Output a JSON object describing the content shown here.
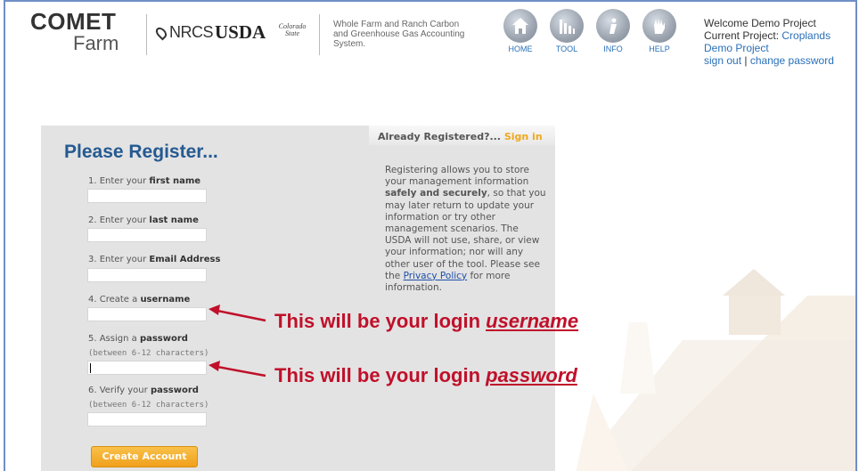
{
  "header": {
    "logo_comet": "COMET",
    "logo_farm": "Farm",
    "logo_nrcs": "NRCS",
    "logo_usda": "USDA",
    "logo_csu": "Colorado State",
    "tagline": "Whole Farm and Ranch Carbon and Greenhouse Gas Accounting System.",
    "nav": [
      {
        "label": "HOME",
        "icon": "home-icon"
      },
      {
        "label": "TOOL",
        "icon": "tool-icon"
      },
      {
        "label": "INFO",
        "icon": "info-icon"
      },
      {
        "label": "HELP",
        "icon": "help-icon"
      }
    ],
    "welcome_line": "Welcome Demo Project",
    "current_project_label": "Current Project:",
    "current_project_value": "Croplands",
    "project_link": "Demo Project",
    "sign_out": "sign out",
    "separator": "|",
    "change_password": "change password"
  },
  "panel": {
    "already_registered": "Already Registered?...",
    "sign_in": "Sign in",
    "title": "Please Register...",
    "fields": [
      {
        "prefix": "1. Enter your ",
        "bold": "first name",
        "note": ""
      },
      {
        "prefix": "2. Enter your ",
        "bold": "last name",
        "note": ""
      },
      {
        "prefix": "3. Enter your ",
        "bold": "Email Address",
        "note": ""
      },
      {
        "prefix": "4. Create a ",
        "bold": "username",
        "note": ""
      },
      {
        "prefix": "5. Assign a ",
        "bold": "password",
        "note": "(between 6-12 characters)"
      },
      {
        "prefix": "6. Verify your ",
        "bold": "password",
        "note": "(between 6-12 characters)"
      }
    ],
    "info_1": "Registering allows you to store your management information ",
    "info_bold": "safely and securely",
    "info_2": ", so that you may later return to update your information or try other management scenarios. The USDA will not use, share, or view your information; nor will any other user of the tool. Please see the ",
    "privacy_link": "Privacy Policy",
    "info_3": " for more information.",
    "create_button": "Create Account"
  },
  "annotations": {
    "username_prefix": "This will be your login ",
    "username_em": "username",
    "password_prefix": "This will be your login ",
    "password_em": "password"
  },
  "colors": {
    "accent_blue": "#255a91",
    "link_blue": "#2a70b8",
    "button_orange": "#f0a01c",
    "annotation_red": "#c0102a",
    "panel_gray": "#e3e3e3"
  }
}
